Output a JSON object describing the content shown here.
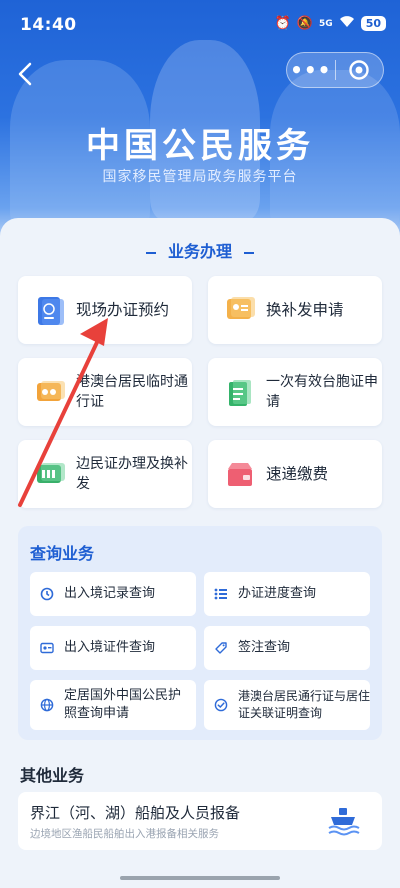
{
  "status_bar": {
    "time": "14:40",
    "battery": "50",
    "network": "5G"
  },
  "nav": {
    "more_label": "•••"
  },
  "hero": {
    "title": "中国公民服务",
    "subtitle": "国家移民管理局政务服务平台"
  },
  "business": {
    "section_title": "业务办理",
    "tiles": [
      {
        "label": "现场办证预约",
        "icon": "passport-icon"
      },
      {
        "label": "换补发申请",
        "icon": "id-card-icon"
      },
      {
        "label": "港澳台居民临时通行证",
        "icon": "pass-card-icon"
      },
      {
        "label": "一次有效台胞证申请",
        "icon": "document-icon"
      },
      {
        "label": "边民证办理及换补发",
        "icon": "border-pass-icon"
      },
      {
        "label": "速递缴费",
        "icon": "package-icon"
      }
    ]
  },
  "query": {
    "title": "查询业务",
    "items": [
      {
        "label": "出入境记录查询",
        "icon": "history-icon"
      },
      {
        "label": "办证进度查询",
        "icon": "progress-list-icon"
      },
      {
        "label": "出入境证件查询",
        "icon": "id-card-icon"
      },
      {
        "label": "签注查询",
        "icon": "tag-icon"
      },
      {
        "label": "定居国外中国公民护照查询申请",
        "icon": "globe-icon"
      },
      {
        "label": "港澳台居民通行证与居住证关联证明查询",
        "icon": "verified-icon"
      }
    ]
  },
  "other": {
    "title": "其他业务",
    "card_title": "界江（河、湖）船舶及人员报备",
    "card_subtitle": "边境地区渔船民船舶出入港报备相关服务"
  },
  "colors": {
    "primary": "#1e5ed2",
    "hero": "#2c72e0",
    "annotation_arrow": "#e8413b"
  }
}
